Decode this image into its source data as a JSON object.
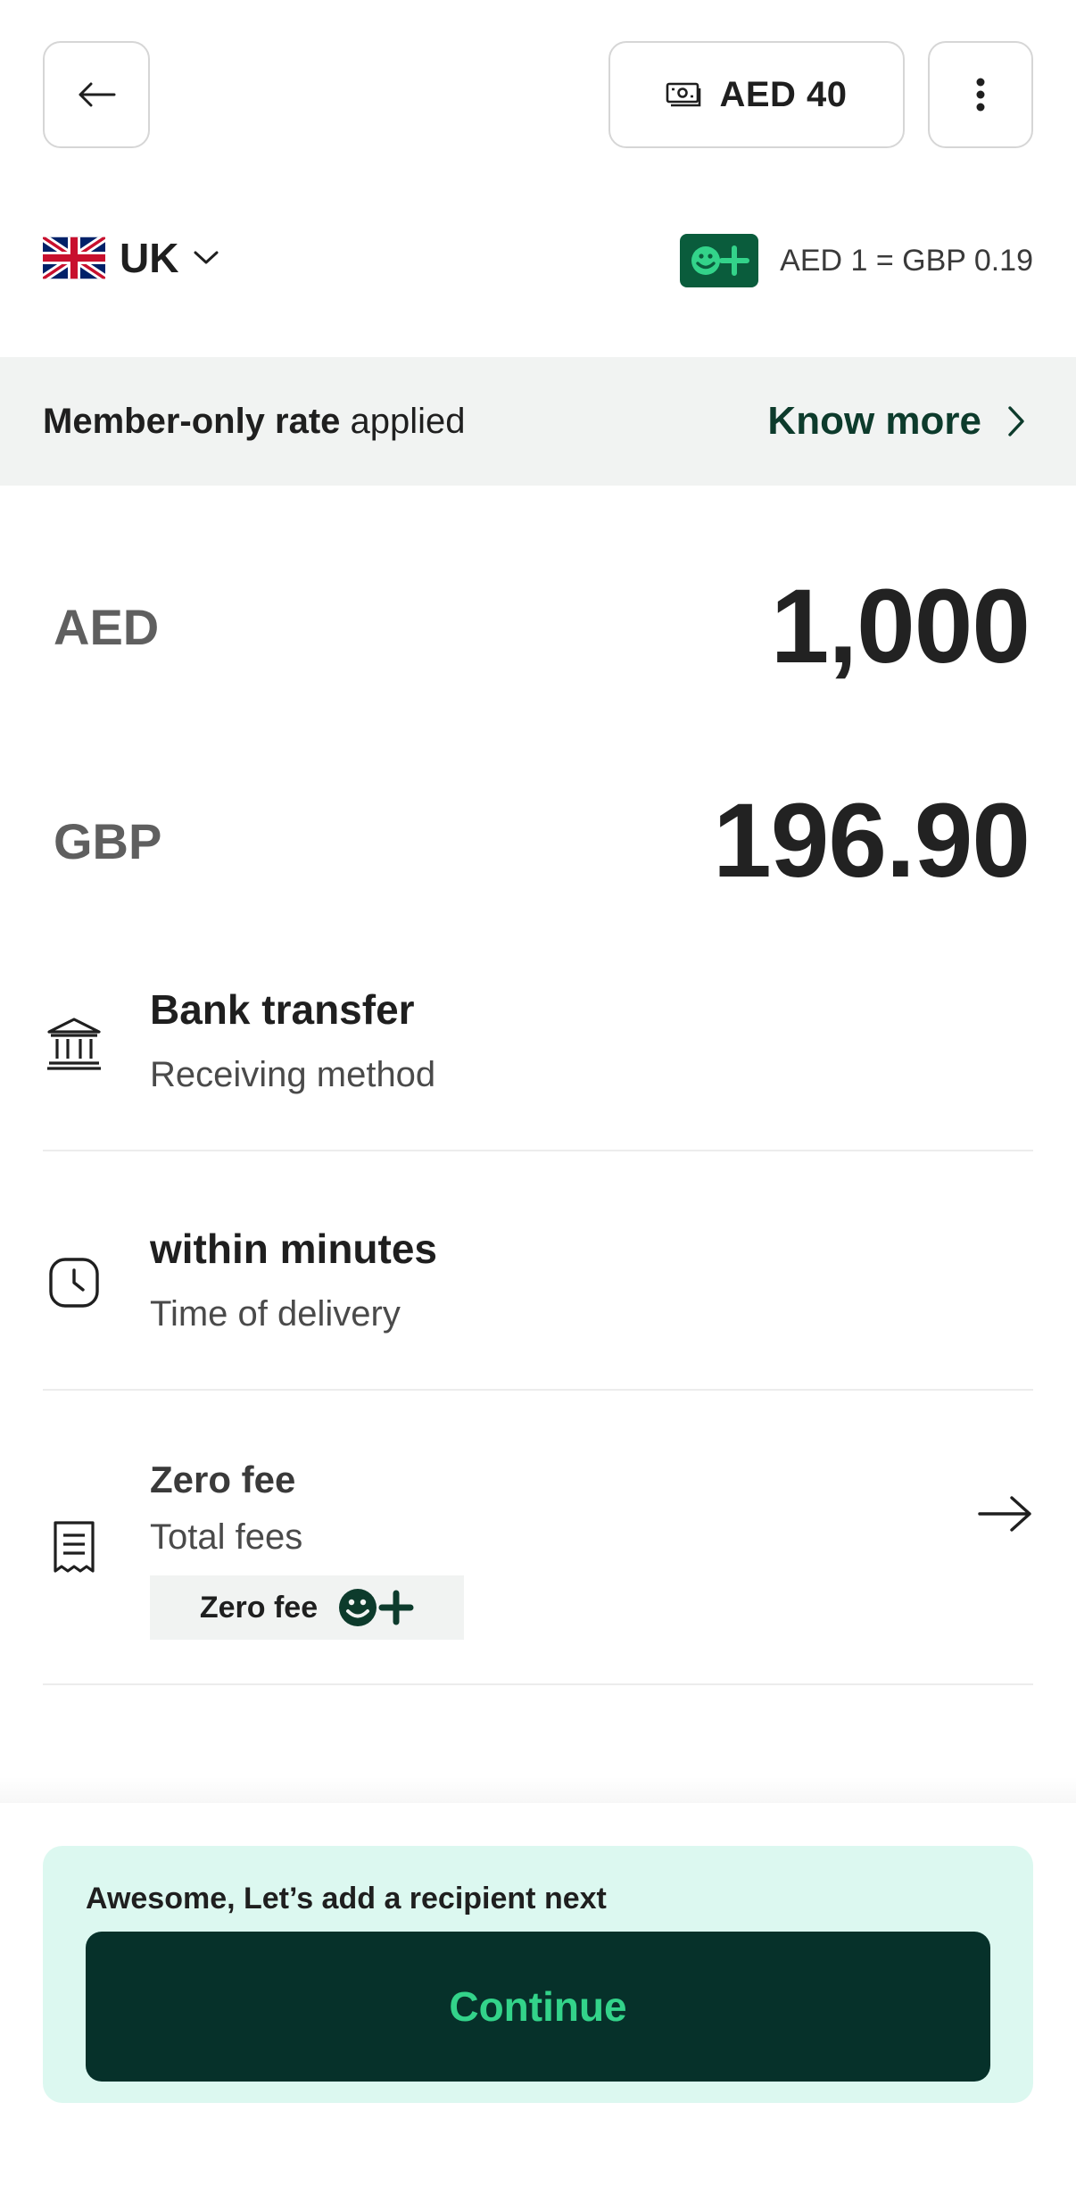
{
  "header": {
    "back_icon": "arrow-left-icon",
    "balance_icon": "cash-icon",
    "balance_label": "AED 40",
    "more_icon": "more-vertical-icon"
  },
  "corridor": {
    "country_label": "UK",
    "flag_icon": "uk-flag-icon",
    "dropdown_icon": "chevron-down-icon",
    "plus_badge_icon": "plus-member-icon",
    "rate_text": "AED 1 = GBP 0.19"
  },
  "member_banner": {
    "bold_text": "Member-only rate",
    "rest_text": " applied",
    "link_label": "Know more",
    "link_icon": "chevron-right-icon"
  },
  "send": {
    "currency": "AED",
    "amount": "1,000"
  },
  "receive": {
    "currency": "GBP",
    "amount": "196.90"
  },
  "details": [
    {
      "icon": "bank-icon",
      "title": "Bank transfer",
      "subtitle": "Receiving method"
    },
    {
      "icon": "clock-icon",
      "title": "within minutes",
      "subtitle": "Time of delivery"
    },
    {
      "icon": "receipt-icon",
      "title": "Zero fee",
      "subtitle": "Total fees",
      "chip_label": "Zero fee",
      "chip_icon": "plus-member-icon",
      "action_icon": "arrow-right-icon"
    }
  ],
  "footer": {
    "hint": "Awesome, Let’s add a recipient next",
    "continue_label": "Continue"
  },
  "colors": {
    "brand_dark": "#06312a",
    "brand_green": "#33d38a",
    "badge_green": "#0a5c3c",
    "banner_bg": "#f1f3f2",
    "cta_bg": "#dcf8f0"
  }
}
